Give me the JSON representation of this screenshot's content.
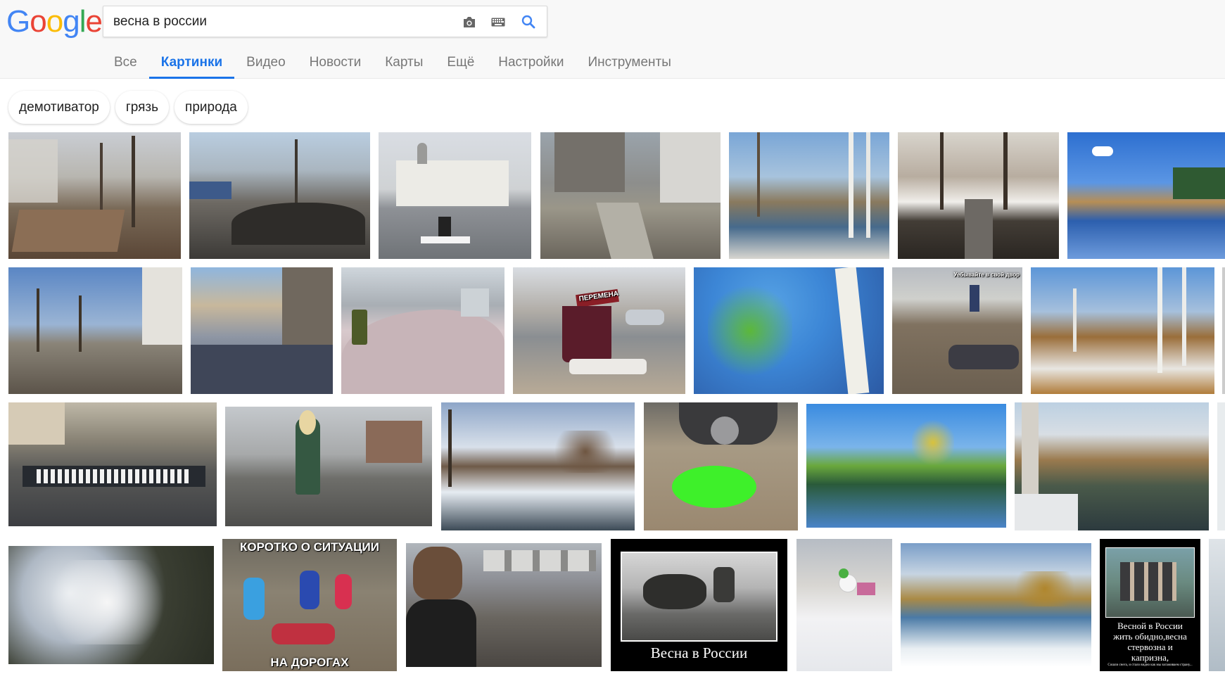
{
  "logo": {
    "letters": [
      "G",
      "o",
      "o",
      "g",
      "l",
      "e"
    ],
    "colors": [
      "#4285f4",
      "#ea4335",
      "#fbbc05",
      "#4285f4",
      "#34a853",
      "#ea4335"
    ]
  },
  "search": {
    "value": "весна в россии",
    "camera_icon": "camera-icon",
    "keyboard_icon": "keyboard-icon",
    "search_icon": "search-icon"
  },
  "tabs": [
    {
      "label": "Все",
      "active": false
    },
    {
      "label": "Картинки",
      "active": true
    },
    {
      "label": "Видео",
      "active": false
    },
    {
      "label": "Новости",
      "active": false
    },
    {
      "label": "Карты",
      "active": false
    },
    {
      "label": "Ещё",
      "active": false
    },
    {
      "label": "Настройки",
      "active": false
    },
    {
      "label": "Инструменты",
      "active": false
    }
  ],
  "chips": [
    {
      "label": "демотиватор"
    },
    {
      "label": "грязь"
    },
    {
      "label": "природа"
    }
  ],
  "images": {
    "row1": [
      "ruined-yard-photo",
      "muddy-street-photo",
      "church-flood-photo",
      "slush-road-photo",
      "birch-river-photo",
      "flooded-alley-photo",
      "blue-lake-photo"
    ],
    "row2": [
      "yard-apartments-photo",
      "snow-street-photo",
      "snow-pile-photo",
      "sleeping-man-photo",
      "birch-leaves-photo",
      "flooded-yard-photo",
      "birch-forest-photo"
    ],
    "row3": [
      "crowd-square-photo",
      "woman-flood-photo",
      "snow-river-photo",
      "green-puddle-photo",
      "green-lake-photo",
      "spring-river-photo"
    ],
    "row4": [
      "cherry-blossom-photo",
      "kids-mud-photo",
      "man-mud-road-photo",
      "demotivator-swim-photo",
      "snowman-photo",
      "winter-river-photo",
      "demotivator-bench-photo"
    ],
    "captions": {
      "sign": "ПЕРЕМЕНА",
      "yard_text": "Уебывайте в свой двор",
      "meme_top": "КОРОТКО О СИТУАЦИИ",
      "meme_bottom": "НА ДОРОГАХ",
      "demotivator": "Весна в России",
      "demotivator2_line1": "Весной в России",
      "demotivator2_line2": "жить обидно,весна",
      "demotivator2_line3": "стервозна и",
      "demotivator2_line4": "капризна,",
      "demotivator2_small": "Сошли снега, и стало видно как мы загаживаем страну..."
    }
  },
  "colors": {
    "active_tab": "#1a73e8",
    "inactive_tab": "#777777",
    "header_bg": "#f8f8f8"
  }
}
